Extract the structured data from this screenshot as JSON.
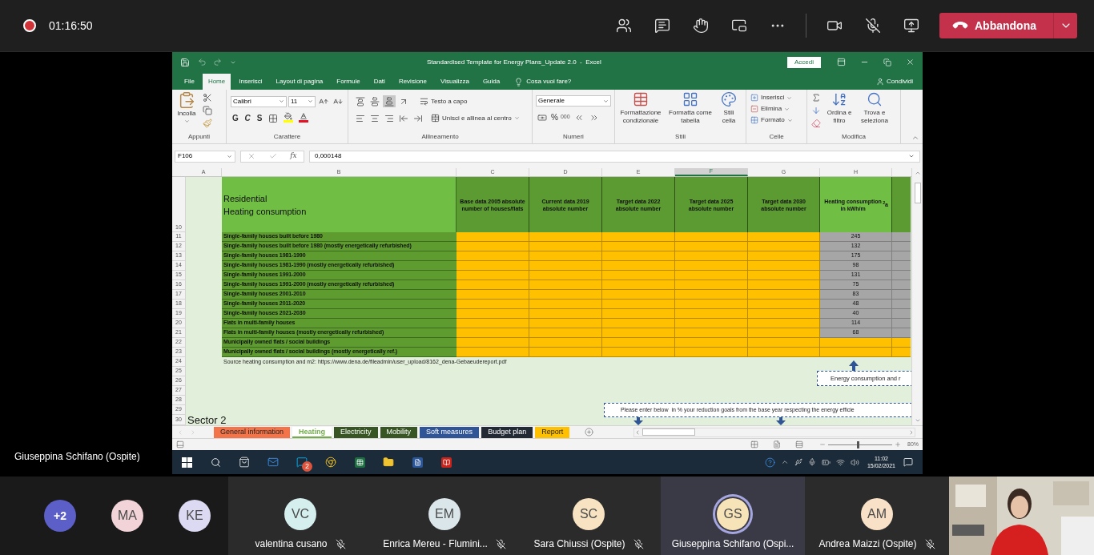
{
  "meeting": {
    "elapsed": "01:16:50",
    "leave_button": "Abbandona",
    "presenter": "Giuseppina Schifano (Ospite)"
  },
  "excel": {
    "title": "Standardised Template for Energy Plans_Update 2.0  -  Excel",
    "sign_in": "Accedi",
    "menu": [
      {
        "label": "File",
        "selected": false
      },
      {
        "label": "Home",
        "selected": true
      },
      {
        "label": "Inserisci",
        "selected": false
      },
      {
        "label": "Layout di pagina",
        "selected": false
      },
      {
        "label": "Formule",
        "selected": false
      },
      {
        "label": "Dati",
        "selected": false
      },
      {
        "label": "Revisione",
        "selected": false
      },
      {
        "label": "Visualizza",
        "selected": false
      },
      {
        "label": "Guida",
        "selected": false
      }
    ],
    "tell_me": "Cosa vuoi fare?",
    "share": "Condividi",
    "ribbon": {
      "clipboard": {
        "label": "Appunti",
        "paste": "Incolla"
      },
      "font": {
        "label": "Carattere",
        "name": "Calibri",
        "size": "11",
        "bold": "G",
        "italic": "C",
        "underline": "S"
      },
      "alignment": {
        "label": "Allineamento",
        "wrap": "Testo a capo",
        "merge": "Unisci e allinea al centro"
      },
      "number": {
        "label": "Numeri",
        "format": "Generale",
        "percent": "%",
        "thousands": "000"
      },
      "styles": {
        "label": "Stili",
        "conditional": "Formattazione condizionale",
        "table": "Formatta come tabella",
        "cell": "Stili cella"
      },
      "cells": {
        "label": "Celle",
        "insert": "Inserisci",
        "delete": "Elimina",
        "format": "Formato"
      },
      "editing": {
        "label": "Modifica",
        "sort": "Ordina e filtro",
        "find": "Trova e seleziona"
      }
    },
    "formula_bar": {
      "name_box": "F106",
      "fx": "fx",
      "value": "0,000148"
    },
    "columns": [
      {
        "label": "A",
        "selected": false
      },
      {
        "label": "B",
        "selected": false
      },
      {
        "label": "C",
        "selected": false
      },
      {
        "label": "D",
        "selected": false
      },
      {
        "label": "E",
        "selected": false
      },
      {
        "label": "F",
        "selected": true
      },
      {
        "label": "G",
        "selected": false
      },
      {
        "label": "H",
        "selected": false
      }
    ],
    "header_row": {
      "row": "10",
      "title": [
        "Residential",
        "Heating consumption"
      ],
      "column_heads": [
        "Base data 2005 absolute number of houses/flats",
        "Current data 2019 absolute number",
        "Target data 2022 absolute number",
        "Target data 2025 absolute number",
        "Target data 2030 absolute number",
        "Heating consumption in kWh/m$^{2}$a"
      ]
    },
    "rows": [
      {
        "row": "11",
        "label": "Single-family houses built before 1980",
        "consumption": "245"
      },
      {
        "row": "12",
        "label": "Single-family houses built before 1980 (mostly energetically refurbished)",
        "consumption": "132"
      },
      {
        "row": "13",
        "label": "Single-family houses 1981-1990",
        "consumption": "175"
      },
      {
        "row": "14",
        "label": "Single-family houses 1981-1990 (mostly energetically refurbished)",
        "consumption": "98"
      },
      {
        "row": "15",
        "label": "Single-family houses 1991-2000",
        "consumption": "131"
      },
      {
        "row": "16",
        "label": "Single-family houses 1991-2000 (mostly energetically refurbished)",
        "consumption": "75"
      },
      {
        "row": "17",
        "label": "Single-family houses 2001-2010",
        "consumption": "83"
      },
      {
        "row": "18",
        "label": "Single-family houses 2011-2020",
        "consumption": "48"
      },
      {
        "row": "19",
        "label": "Single-family houses 2021-2030",
        "consumption": "40"
      },
      {
        "row": "20",
        "label": "Flats in multi-family houses",
        "consumption": "114"
      },
      {
        "row": "21",
        "label": "Flats in multi-family houses (mostly energetically refurbished)",
        "consumption": "68"
      },
      {
        "row": "22",
        "label": "Municipally owned flats / social buildings"
      },
      {
        "row": "23",
        "label": "Municipally owned flats / social buildings (mostly energetically ref.)"
      }
    ],
    "lower_rows": [
      {
        "row": "24",
        "kind": "source",
        "text": "Source heating consumption and m2: https://www.dena.de/fileadmin/user_upload/8162_dena-Gebaeudereport.pdf"
      },
      {
        "row": "25"
      },
      {
        "row": "26"
      },
      {
        "row": "27"
      },
      {
        "row": "28"
      },
      {
        "row": "29"
      },
      {
        "row": "30",
        "kind": "heading",
        "text": "Sector 2"
      }
    ],
    "notes": [
      "Energy consumption and r",
      "Please enter below  in % your reduction goals from the base year respecting the energy efficie"
    ],
    "sheet_tabs": [
      {
        "label": "General information",
        "color": "#f4744a",
        "selected": false
      },
      {
        "label": "Heating",
        "color": "#70ad47",
        "selected": true
      },
      {
        "label": "Electricity",
        "color": "#375623",
        "selected": false
      },
      {
        "label": "Mobility",
        "color": "#375623",
        "selected": false
      },
      {
        "label": "Soft measures",
        "color": "#2f5597",
        "selected": false
      },
      {
        "label": "Budget plan",
        "color": "#222a35",
        "selected": false
      },
      {
        "label": "Report",
        "color": "#ffc000",
        "selected": false
      }
    ],
    "zoom": {
      "reading": "80%",
      "level": 0.45
    }
  },
  "taskbar": {
    "skype_badge": "2",
    "time": "11:02",
    "date": "15/02/2021"
  },
  "participants": {
    "overflow": "+2",
    "avatars": [
      {
        "initials": "MA",
        "color": "#f1d3d8"
      },
      {
        "initials": "KE",
        "color": "#dcdaf2"
      }
    ],
    "tiles": [
      {
        "initials": "VC",
        "name": "valentina cusano",
        "color": "#d5eeee",
        "muted": true,
        "speaking": false
      },
      {
        "initials": "EM",
        "name": "Enrica Mereu - Flumini...",
        "color": "#dbe6ea",
        "muted": true,
        "speaking": false
      },
      {
        "initials": "SC",
        "name": "Sara Chiussi (Ospite)",
        "color": "#f7e3c1",
        "muted": true,
        "speaking": false
      },
      {
        "initials": "GS",
        "name": "Giuseppina Schifano (Ospi...",
        "color": "#f7e3b8",
        "muted": false,
        "speaking": true
      },
      {
        "initials": "AM",
        "name": "Andrea Maizzi (Ospite)",
        "color": "#f9e1c7",
        "muted": true,
        "speaking": false
      }
    ]
  }
}
